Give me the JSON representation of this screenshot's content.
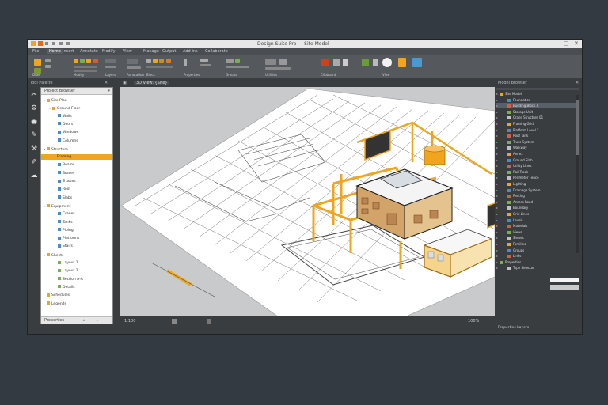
{
  "window": {
    "title": "Design Suite Pro — Site Model",
    "controls": {
      "minimize": "–",
      "maximize": "□",
      "close": "✕"
    }
  },
  "menu_tabs": [
    "File",
    "Home",
    "Insert",
    "Annotate",
    "Modify",
    "View",
    "Manage",
    "Output",
    "Add-ins",
    "Collaborate"
  ],
  "ribbon": {
    "groups": [
      {
        "label": "Draw"
      },
      {
        "label": "Modify"
      },
      {
        "label": "Layers"
      },
      {
        "label": "Annotation"
      },
      {
        "label": "Block"
      },
      {
        "label": "Properties"
      },
      {
        "label": "Groups"
      },
      {
        "label": "Utilities"
      },
      {
        "label": "Clipboard"
      },
      {
        "label": "View"
      }
    ]
  },
  "left_panel": {
    "header": "Tool Palette",
    "browser_header": "Project Browser",
    "items": [
      {
        "label": "Site Plan",
        "level": 0,
        "expanded": true,
        "selected": false,
        "icon": "folder-icon"
      },
      {
        "label": "Ground Floor",
        "level": 1,
        "expanded": true,
        "selected": false,
        "icon": "folder-icon"
      },
      {
        "label": "Walls",
        "level": 2,
        "selected": false,
        "icon": "layer-icon"
      },
      {
        "label": "Doors",
        "level": 2,
        "selected": false,
        "icon": "layer-icon"
      },
      {
        "label": "Windows",
        "level": 2,
        "selected": false,
        "icon": "layer-icon"
      },
      {
        "label": "Columns",
        "level": 2,
        "selected": false,
        "icon": "layer-icon"
      },
      {
        "label": "Structure",
        "level": 0,
        "expanded": true,
        "selected": false,
        "icon": "folder-icon"
      },
      {
        "label": "Framing",
        "level": 1,
        "selected": true,
        "icon": "folder-icon"
      },
      {
        "label": "Beams",
        "level": 2,
        "selected": false,
        "icon": "layer-icon"
      },
      {
        "label": "Braces",
        "level": 2,
        "selected": false,
        "icon": "layer-icon"
      },
      {
        "label": "Trusses",
        "level": 2,
        "selected": false,
        "icon": "layer-icon"
      },
      {
        "label": "Roof",
        "level": 2,
        "selected": false,
        "icon": "layer-icon"
      },
      {
        "label": "Slabs",
        "level": 2,
        "selected": false,
        "icon": "layer-icon"
      },
      {
        "label": "Equipment",
        "level": 0,
        "expanded": true,
        "selected": false,
        "icon": "folder-icon"
      },
      {
        "label": "Cranes",
        "level": 2,
        "selected": false,
        "icon": "layer-icon"
      },
      {
        "label": "Tanks",
        "level": 2,
        "selected": false,
        "icon": "layer-icon"
      },
      {
        "label": "Piping",
        "level": 2,
        "selected": false,
        "icon": "layer-icon"
      },
      {
        "label": "Platforms",
        "level": 2,
        "selected": false,
        "icon": "layer-icon"
      },
      {
        "label": "Stairs",
        "level": 2,
        "selected": false,
        "icon": "layer-icon"
      },
      {
        "label": "Sheets",
        "level": 0,
        "expanded": true,
        "selected": false,
        "icon": "folder-icon"
      },
      {
        "label": "Layout 1",
        "level": 2,
        "selected": false,
        "icon": "sheet-icon"
      },
      {
        "label": "Layout 2",
        "level": 2,
        "selected": false,
        "icon": "sheet-icon"
      },
      {
        "label": "Section A-A",
        "level": 2,
        "selected": false,
        "icon": "sheet-icon"
      },
      {
        "label": "Details",
        "level": 2,
        "selected": false,
        "icon": "sheet-icon"
      },
      {
        "label": "Schedules",
        "level": 0,
        "selected": false,
        "icon": "folder-icon"
      },
      {
        "label": "Legends",
        "level": 0,
        "selected": false,
        "icon": "folder-icon"
      }
    ],
    "footer": "Properties"
  },
  "canvas": {
    "tab_label": "3D View: {Site}",
    "status": {
      "scale": "1:100",
      "zoom": "100%"
    }
  },
  "right_panel": {
    "header": "Model Browser",
    "tree": [
      {
        "label": "Site Model",
        "level": 0
      },
      {
        "label": "Foundation",
        "level": 1
      },
      {
        "label": "Building Block A",
        "level": 1,
        "selected": true
      },
      {
        "label": "Storage Unit",
        "level": 1
      },
      {
        "label": "Crane Structure 01",
        "level": 1
      },
      {
        "label": "Framing Grid",
        "level": 1
      },
      {
        "label": "Platform Level 2",
        "level": 1
      },
      {
        "label": "Roof Tank",
        "level": 1
      },
      {
        "label": "Truss System",
        "level": 1
      },
      {
        "label": "Walkway",
        "level": 1
      },
      {
        "label": "Annex",
        "level": 1
      },
      {
        "label": "Ground Slab",
        "level": 1
      },
      {
        "label": "Utility Lines",
        "level": 1
      },
      {
        "label": "Rail Track",
        "level": 1
      },
      {
        "label": "Perimeter Fence",
        "level": 1
      },
      {
        "label": "Lighting",
        "level": 1
      },
      {
        "label": "Drainage System",
        "level": 1
      },
      {
        "label": "Parking",
        "level": 1
      },
      {
        "label": "Access Road",
        "level": 1
      },
      {
        "label": "Boundary",
        "level": 1
      },
      {
        "label": "Grid Lines",
        "level": 1
      },
      {
        "label": "Levels",
        "level": 1
      },
      {
        "label": "Materials",
        "level": 1
      },
      {
        "label": "Views",
        "level": 1
      },
      {
        "label": "Sheets",
        "level": 1
      },
      {
        "label": "Families",
        "level": 1
      },
      {
        "label": "Groups",
        "level": 1
      },
      {
        "label": "Links",
        "level": 1
      },
      {
        "label": "Properties",
        "level": 0
      },
      {
        "label": "Type Selector",
        "level": 1
      }
    ],
    "footer": "Properties  Layers"
  },
  "colors": {
    "accent": "#f0a51e",
    "canvas_bg": "#c8cacc",
    "ui_dark": "#3a3d40",
    "ribbon": "#55595d",
    "floor": "#ffffff"
  }
}
